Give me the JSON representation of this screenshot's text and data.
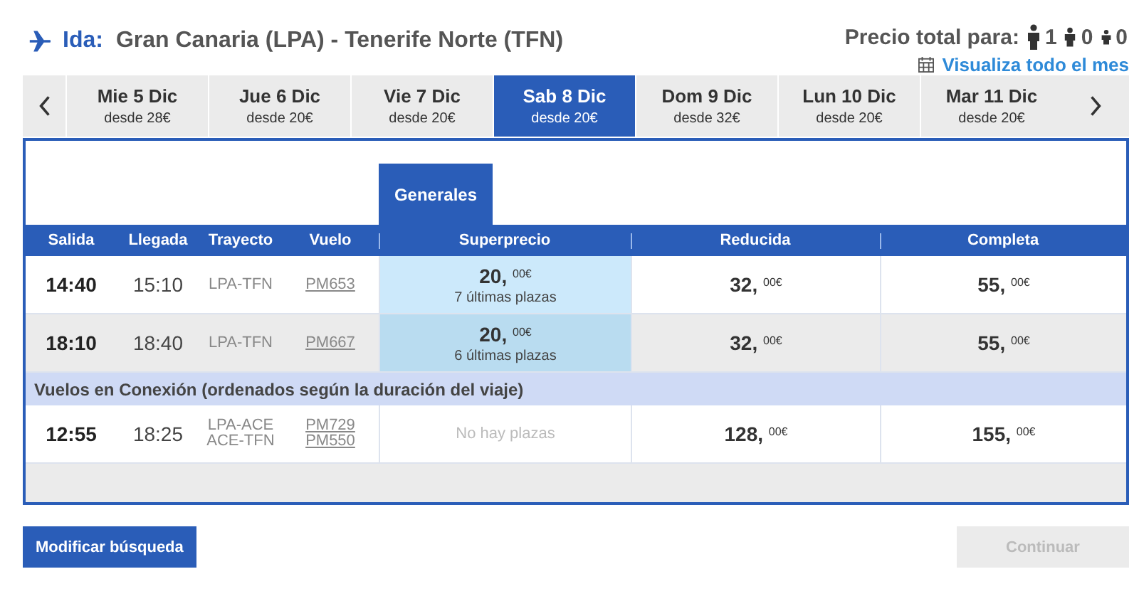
{
  "trip": {
    "label": "Ida:",
    "route": "Gran Canaria (LPA) - Tenerife Norte (TFN)"
  },
  "passengers": {
    "label": "Precio total para:",
    "counts": [
      {
        "kind": "adult",
        "count": "1"
      },
      {
        "kind": "child",
        "count": "0"
      },
      {
        "kind": "infant",
        "count": "0"
      }
    ]
  },
  "month_link": "Visualiza todo el mes",
  "dates": [
    {
      "day": "Mie 5 Dic",
      "price": "desde 28€",
      "selected": false
    },
    {
      "day": "Jue 6 Dic",
      "price": "desde 20€",
      "selected": false
    },
    {
      "day": "Vie 7 Dic",
      "price": "desde 20€",
      "selected": false
    },
    {
      "day": "Sab 8 Dic",
      "price": "desde 20€",
      "selected": true
    },
    {
      "day": "Dom 9 Dic",
      "price": "desde 32€",
      "selected": false
    },
    {
      "day": "Lun 10 Dic",
      "price": "desde 20€",
      "selected": false
    },
    {
      "day": "Mar 11 Dic",
      "price": "desde 20€",
      "selected": false
    }
  ],
  "fare_tab": "Generales",
  "columns": [
    "Salida",
    "Llegada",
    "Trayecto",
    "Vuelo",
    "Superprecio",
    "Reducida",
    "Completa"
  ],
  "rows": [
    {
      "kind": "flight",
      "departure": "14:40",
      "arrival": "15:10",
      "routes": [
        "LPA-TFN"
      ],
      "flights": [
        "PM653"
      ],
      "fares": [
        {
          "kind": "offer",
          "price": "**20,** $^{00€}$",
          "note": "7 últimas plazas"
        },
        {
          "kind": "price",
          "price": "**32,** $^{00€}$"
        },
        {
          "kind": "price",
          "price": "**55,** $^{00€}$"
        }
      ]
    },
    {
      "kind": "flight",
      "departure": "18:10",
      "arrival": "18:40",
      "routes": [
        "LPA-TFN"
      ],
      "flights": [
        "PM667"
      ],
      "fares": [
        {
          "kind": "offer",
          "price": "**20,** $^{00€}$",
          "note": "6 últimas plazas"
        },
        {
          "kind": "price",
          "price": "**32,** $^{00€}$"
        },
        {
          "kind": "price",
          "price": "**55,** $^{00€}$"
        }
      ]
    },
    {
      "kind": "section",
      "title": "Vuelos en Conexión (ordenados según la duración del viaje)"
    },
    {
      "kind": "flight",
      "departure": "12:55",
      "arrival": "18:25",
      "routes": [
        "LPA-ACE",
        "ACE-TFN"
      ],
      "flights": [
        "PM729",
        "PM550"
      ],
      "fares": [
        {
          "kind": "none",
          "note": "No hay plazas"
        },
        {
          "kind": "price",
          "price": "**128,** $^{00€}$"
        },
        {
          "kind": "price",
          "price": "**155,** $^{00€}$"
        }
      ]
    }
  ],
  "buttons": [
    {
      "label": "Modificar búsqueda",
      "disabled": false
    },
    {
      "label": "Continuar",
      "disabled": true
    }
  ]
}
